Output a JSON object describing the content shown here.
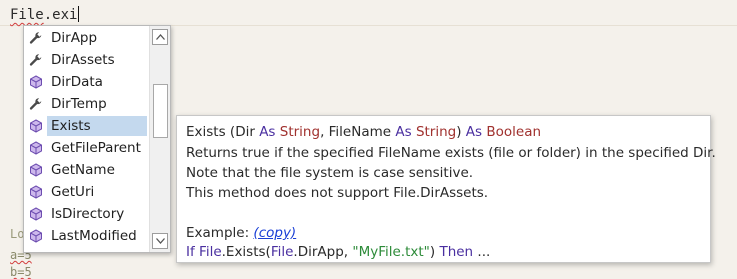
{
  "editor": {
    "typed_prefix": "File",
    "typed_dot": ".",
    "typed_suffix": "exi",
    "bg_line_lo": "Lo",
    "bg_line_a": "a=5",
    "bg_line_b": "b=5"
  },
  "completion": {
    "items": [
      {
        "label": "DirApp",
        "icon": "wrench-icon"
      },
      {
        "label": "DirAssets",
        "icon": "wrench-icon"
      },
      {
        "label": "DirData",
        "icon": "method-cube-icon"
      },
      {
        "label": "DirTemp",
        "icon": "wrench-icon"
      },
      {
        "label": "Exists",
        "icon": "method-cube-icon",
        "selected": true
      },
      {
        "label": "GetFileParent",
        "icon": "method-cube-icon"
      },
      {
        "label": "GetName",
        "icon": "method-cube-icon"
      },
      {
        "label": "GetUri",
        "icon": "method-cube-icon"
      },
      {
        "label": "IsDirectory",
        "icon": "method-cube-icon"
      },
      {
        "label": "LastModified",
        "icon": "method-cube-icon"
      }
    ],
    "scroll_up_icon": "arrow-up-icon",
    "scroll_down_icon": "arrow-down-icon"
  },
  "tooltip": {
    "sig_name": "Exists (Dir ",
    "sig_as1": "As",
    "sig_type1": "String",
    "sig_mid": ", FileName ",
    "sig_as2": "As",
    "sig_type2": "String",
    "sig_close": ") ",
    "sig_as3": "As",
    "sig_type3": "Boolean",
    "desc_1": "Returns true if the specified FileName exists (file or folder) in the specified Dir.",
    "desc_2": "Note that the file system is case sensitive.",
    "desc_3": "This method does not support File.DirAssets.",
    "example_label": "Example: ",
    "copy_link": "(copy)",
    "code_if": "If",
    "code_file": "File",
    "code_exists": ".Exists(",
    "code_file2": "File",
    "code_dirapp": ".DirApp, ",
    "code_str": "\"MyFile.txt\"",
    "code_close": ") ",
    "code_then": "Then",
    "code_ellipsis": " ..."
  },
  "colors": {
    "keyword": "#4a2fa0",
    "type": "#a0312e",
    "string": "#2d8b39",
    "link": "#1a3fd6",
    "selection": "#c4d9ee"
  }
}
